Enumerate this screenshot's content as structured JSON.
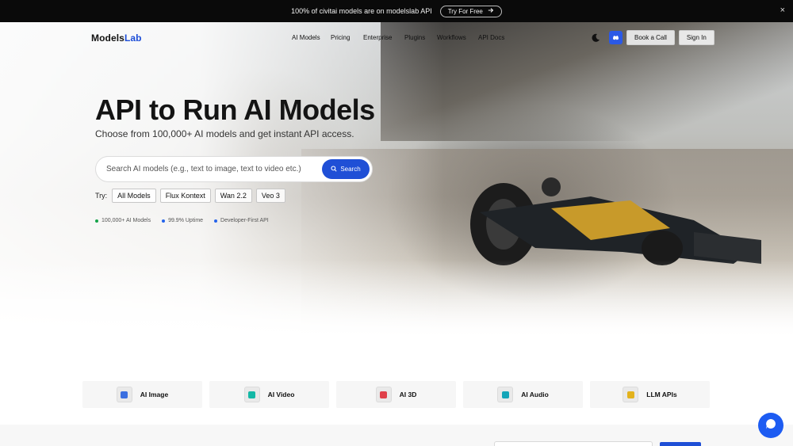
{
  "announcement": {
    "message": "100% of civitai models are on modelslab API",
    "cta_label": "Try For Free"
  },
  "nav": {
    "logo_part1": "Models",
    "logo_part2": "Lab",
    "links": [
      "AI Models",
      "Pricing",
      "Enterprise",
      "Plugins",
      "Workflows",
      "API Docs"
    ],
    "book_call": "Book a Call",
    "sign_in": "Sign In"
  },
  "hero": {
    "title": "API to Run AI Models",
    "subtitle": "Choose from 100,000+ AI models and get instant API access.",
    "search_placeholder": "Search AI models (e.g., text to image, text to video etc.)",
    "search_button": "Search",
    "try_label": "Try:",
    "chips": [
      "All Models",
      "Flux Kontext",
      "Wan 2.2",
      "Veo 3"
    ],
    "stats": [
      {
        "label": "100,000+ AI Models",
        "color": "#16a34a"
      },
      {
        "label": "99.9% Uptime",
        "color": "#2563eb"
      },
      {
        "label": "Developer-First API",
        "color": "#2563eb"
      }
    ]
  },
  "categories": [
    {
      "label": "AI Image",
      "icon": "image-icon",
      "color": "#3b6fe0"
    },
    {
      "label": "AI Video",
      "icon": "video-icon",
      "color": "#14b8a6"
    },
    {
      "label": "AI 3D",
      "icon": "cube-icon",
      "color": "#e0404a"
    },
    {
      "label": "AI Audio",
      "icon": "audio-icon",
      "color": "#14a5b8"
    },
    {
      "label": "LLM APIs",
      "icon": "chat-icon",
      "color": "#e3b21c"
    }
  ],
  "colors": {
    "accent": "#1f4fd6",
    "announce_bg": "#0a0a0a"
  }
}
